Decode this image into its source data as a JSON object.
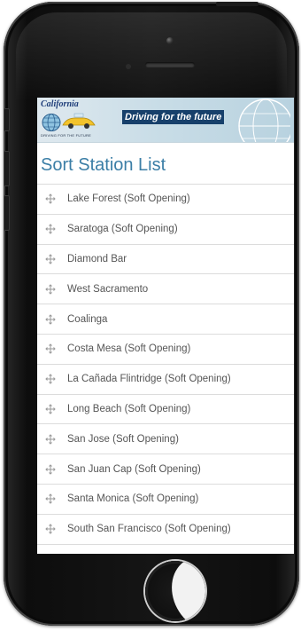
{
  "banner": {
    "logo_text": "California",
    "sub_text": "DRIVING FOR THE FUTURE",
    "tagline": "Driving for the future"
  },
  "page": {
    "title": "Sort Station List"
  },
  "stations": [
    {
      "label": "Lake Forest (Soft Opening)"
    },
    {
      "label": "Saratoga (Soft Opening)"
    },
    {
      "label": "Diamond Bar"
    },
    {
      "label": "West Sacramento"
    },
    {
      "label": "Coalinga"
    },
    {
      "label": "Costa Mesa (Soft Opening)"
    },
    {
      "label": "La Cañada Flintridge (Soft Opening)"
    },
    {
      "label": "Long Beach (Soft Opening)"
    },
    {
      "label": "San Jose (Soft Opening)"
    },
    {
      "label": "San Juan Cap (Soft Opening)"
    },
    {
      "label": "Santa Monica (Soft Opening)"
    },
    {
      "label": "South San Francisco (Soft Opening)"
    }
  ],
  "icons": {
    "drag_handle": "move-icon"
  },
  "colors": {
    "title": "#3b7ea6",
    "tagline_bg": "#17406b",
    "banner_bg": "#c9dde7"
  }
}
